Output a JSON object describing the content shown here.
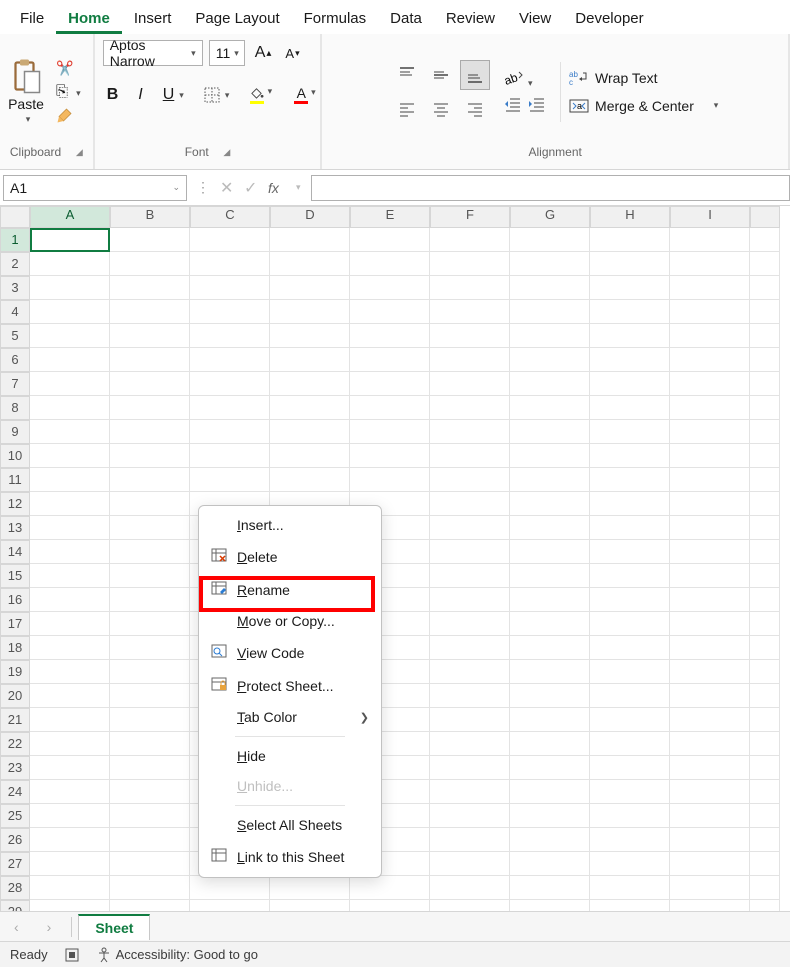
{
  "tabs": [
    "File",
    "Home",
    "Insert",
    "Page Layout",
    "Formulas",
    "Data",
    "Review",
    "View",
    "Developer"
  ],
  "active_tab": "Home",
  "ribbon": {
    "clipboard": {
      "label": "Clipboard",
      "paste": "Paste"
    },
    "font": {
      "label": "Font",
      "name": "Aptos Narrow",
      "size": "11"
    },
    "alignment": {
      "label": "Alignment",
      "wrap": "Wrap Text",
      "merge": "Merge & Center"
    }
  },
  "namebox": "A1",
  "cols": [
    "A",
    "B",
    "C",
    "D",
    "E",
    "F",
    "G",
    "H",
    "I"
  ],
  "rows": 30,
  "selected": {
    "row": 1,
    "col": "A"
  },
  "context": {
    "items": [
      {
        "icon": "",
        "label": "Insert...",
        "u": 0
      },
      {
        "icon": "delete",
        "label": "Delete",
        "u": 0
      },
      {
        "icon": "rename",
        "label": "Rename",
        "u": 0
      },
      {
        "icon": "",
        "label": "Move or Copy...",
        "u": 0
      },
      {
        "icon": "code",
        "label": "View Code",
        "u": 0
      },
      {
        "icon": "protect",
        "label": "Protect Sheet...",
        "u": 0
      },
      {
        "icon": "",
        "label": "Tab Color",
        "u": 0,
        "arrow": true,
        "sep_after": true
      },
      {
        "icon": "",
        "label": "Hide",
        "u": 0
      },
      {
        "icon": "",
        "label": "Unhide...",
        "u": 0,
        "disabled": true,
        "sep_after": true
      },
      {
        "icon": "",
        "label": "Select All Sheets",
        "u": 0
      },
      {
        "icon": "link",
        "label": "Link to this Sheet",
        "u": 0
      }
    ]
  },
  "sheet_tab": "Sheet",
  "status": {
    "ready": "Ready",
    "access": "Accessibility: Good to go"
  }
}
